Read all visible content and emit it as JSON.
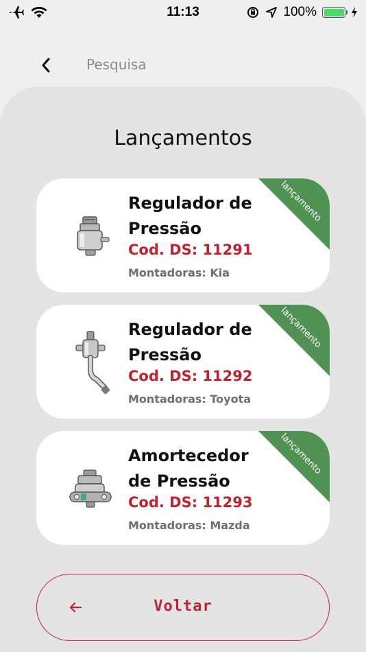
{
  "status_bar": {
    "time": "11:13",
    "battery_text": "100%",
    "battery_level": 1.0,
    "icons": [
      "airplane-icon",
      "wifi-icon",
      "orientation-lock-icon",
      "location-icon",
      "battery-icon",
      "charging-icon"
    ]
  },
  "header": {
    "back_icon": "chevron-left-icon",
    "title": "Pesquisa"
  },
  "page": {
    "section_title": "Lançamentos"
  },
  "products": [
    {
      "name": "Regulador de Pressão",
      "code": "Cod. DS: 11291",
      "maker": "Montadoras: Kia",
      "ribbon": "lançamento"
    },
    {
      "name": "Regulador de Pressão",
      "code": "Cod. DS: 11292",
      "maker": "Montadoras: Toyota",
      "ribbon": "lançamento"
    },
    {
      "name": "Amortecedor de Pressão",
      "code": "Cod. DS: 11293",
      "maker": "Montadoras: Mazda",
      "ribbon": "lançamento"
    }
  ],
  "footer": {
    "back_label": "Voltar",
    "back_icon": "arrow-left-icon"
  },
  "colors": {
    "accent_red": "#c0232f",
    "ribbon_green": "#4f9254",
    "background": "#efefef",
    "panel": "#e4e4e4",
    "battery_green": "#4cd964"
  }
}
